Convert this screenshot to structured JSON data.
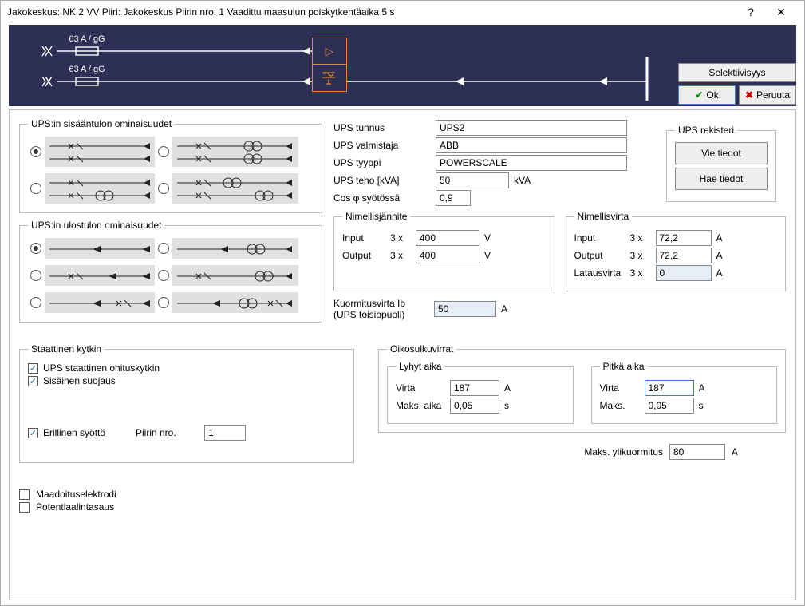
{
  "window": {
    "title": "Jakokeskus: NK 2 VV     Piiri: Jakokeskus     Piirin nro: 1   Vaadittu maasulun poiskytkentäaika 5 s",
    "help": "?",
    "close": "✕"
  },
  "diagram": {
    "fuse1": "63 A / gG",
    "fuse2": "63 A / gG"
  },
  "actions": {
    "select": "Selektiivisyys",
    "ok": "Ok",
    "cancel": "Peruuta"
  },
  "input_props": {
    "legend": "UPS:in sisääntulon ominaisuudet"
  },
  "output_props": {
    "legend": "UPS:in ulostulon ominaisuudet"
  },
  "ups": {
    "id_label": "UPS tunnus",
    "id": "UPS2",
    "make_label": "UPS valmistaja",
    "make": "ABB",
    "type_label": "UPS tyyppi",
    "type": "POWERSCALE",
    "power_label": "UPS teho [kVA]",
    "power": "50",
    "power_unit": "kVA",
    "cos_label": "Cos  φ   syötössä",
    "cos": "0,9"
  },
  "ups_reg": {
    "legend": "UPS rekisteri",
    "export": "Vie tiedot",
    "import": "Hae tiedot"
  },
  "nom_v": {
    "legend": "Nimellisjännite",
    "in_lbl": "Input",
    "in_mul": "3 x",
    "in_v": "400",
    "in_u": "V",
    "out_lbl": "Output",
    "out_mul": "3 x",
    "out_v": "400",
    "out_u": "V"
  },
  "nom_i": {
    "legend": "Nimellisvirta",
    "in_lbl": "Input",
    "in_mul": "3 x",
    "in_v": "72,2",
    "in_u": "A",
    "out_lbl": "Output",
    "out_mul": "3 x",
    "out_v": "72,2",
    "out_u": "A",
    "ch_lbl": "Latausvirta",
    "ch_mul": "3 x",
    "ch_v": "0",
    "ch_u": "A"
  },
  "load": {
    "label": "Kuormitusvirta Ib\n(UPS toisiopuoli)",
    "v": "50",
    "u": "A"
  },
  "static": {
    "legend": "Staattinen kytkin",
    "bypass": "UPS staattinen ohituskytkin",
    "protect": "Sisäinen suojaus",
    "sep": "Erillinen syöttö",
    "circuit_lbl": "Piirin nro.",
    "circuit": "1"
  },
  "shorts": {
    "legend": "Oikosulkuvirrat",
    "short_leg": "Lyhyt aika",
    "long_leg": "Pitkä aika",
    "i_lbl": "Virta",
    "t_lbl": "Maks. aika",
    "t_lbl2": "Maks.",
    "s_i": "187",
    "s_t": "0,05",
    "l_i": "187",
    "l_t": "0,05",
    "u_a": "A",
    "u_s": "s"
  },
  "overload": {
    "label": "Maks. ylikuormitus",
    "v": "80",
    "u": "A"
  },
  "ground": {
    "electrode": "Maadoituselektrodi",
    "bonding": "Potentiaalintasaus"
  }
}
